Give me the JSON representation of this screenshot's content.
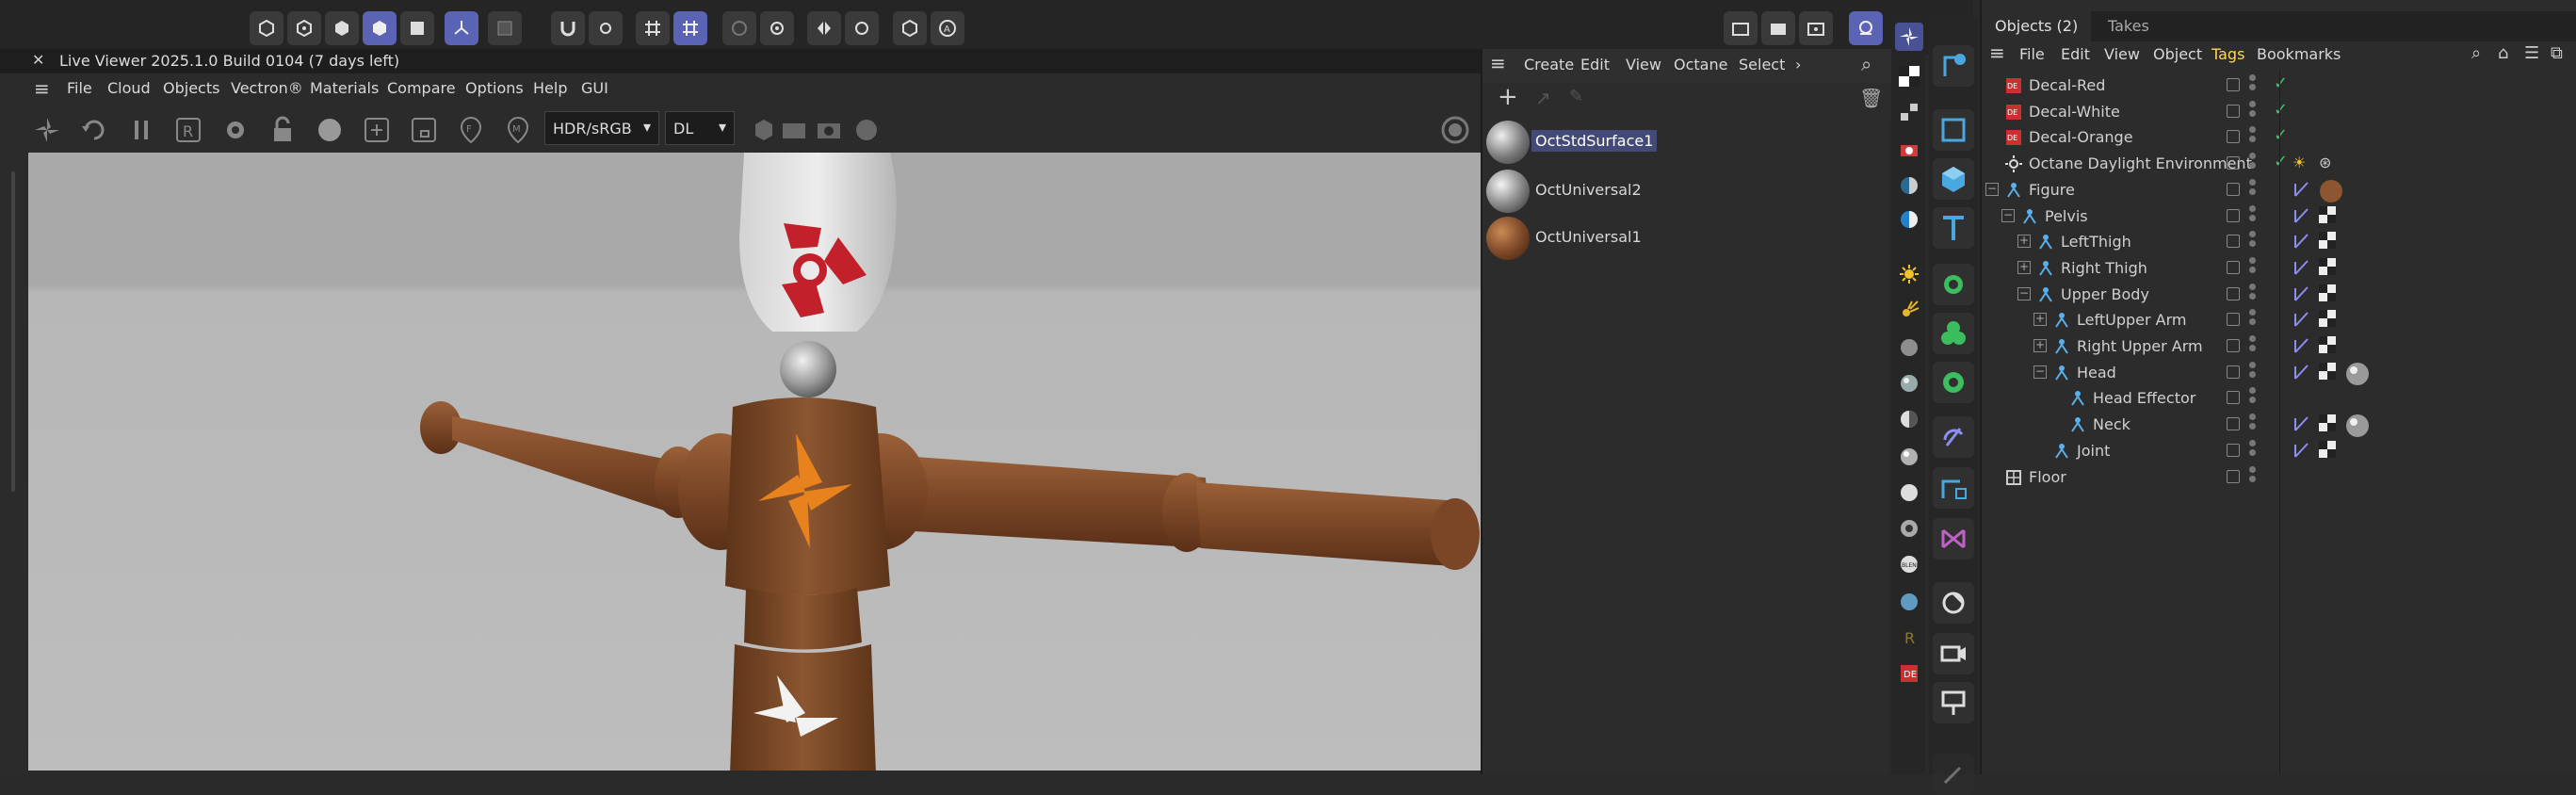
{
  "live_viewer": {
    "title": "Live Viewer 2025.1.0 Build 0104 (7 days left)",
    "menu": [
      "File",
      "Cloud",
      "Objects",
      "Vectron®",
      "Materials",
      "Compare",
      "Options",
      "Help",
      "GUI"
    ],
    "color_space": "HDR/sRGB",
    "kernel": "DL"
  },
  "material_manager": {
    "menu": [
      "Create",
      "Edit",
      "View",
      "Octane",
      "Select"
    ],
    "materials": [
      {
        "name": "OctStdSurface1",
        "selected": true
      },
      {
        "name": "OctUniversal2",
        "selected": false
      },
      {
        "name": "OctUniversal1",
        "selected": false
      }
    ]
  },
  "object_manager": {
    "tabs": [
      "Objects (2)",
      "Takes"
    ],
    "menu": [
      "File",
      "Edit",
      "View",
      "Object",
      "Tags",
      "Bookmarks"
    ],
    "objects": [
      {
        "name": "Decal-Red",
        "depth": 0,
        "icon": "decal",
        "tree": ""
      },
      {
        "name": "Decal-White",
        "depth": 0,
        "icon": "decal",
        "tree": ""
      },
      {
        "name": "Decal-Orange",
        "depth": 0,
        "icon": "decal",
        "tree": ""
      },
      {
        "name": "Octane Daylight Environment",
        "depth": 0,
        "icon": "daylight",
        "tree": ""
      },
      {
        "name": "Figure",
        "depth": 0,
        "icon": "joint",
        "tree": "-"
      },
      {
        "name": "Pelvis",
        "depth": 1,
        "icon": "joint",
        "tree": "-"
      },
      {
        "name": "LeftThigh",
        "depth": 2,
        "icon": "joint",
        "tree": "+"
      },
      {
        "name": "Right Thigh",
        "depth": 2,
        "icon": "joint",
        "tree": "+"
      },
      {
        "name": "Upper Body",
        "depth": 2,
        "icon": "joint",
        "tree": "-"
      },
      {
        "name": "LeftUpper Arm",
        "depth": 3,
        "icon": "joint",
        "tree": "+"
      },
      {
        "name": "Right Upper Arm",
        "depth": 3,
        "icon": "joint",
        "tree": "+"
      },
      {
        "name": "Head",
        "depth": 3,
        "icon": "joint",
        "tree": "-"
      },
      {
        "name": "Head Effector",
        "depth": 4,
        "icon": "joint",
        "tree": ""
      },
      {
        "name": "Neck",
        "depth": 4,
        "icon": "joint",
        "tree": ""
      },
      {
        "name": "Joint",
        "depth": 3,
        "icon": "joint",
        "tree": ""
      },
      {
        "name": "Floor",
        "depth": 0,
        "icon": "floor",
        "tree": ""
      }
    ]
  },
  "colors": {
    "accent": "#5a63b4",
    "panel": "#2c2c2c",
    "check": "#3cc46a",
    "selected_text": "#ffd55a"
  }
}
